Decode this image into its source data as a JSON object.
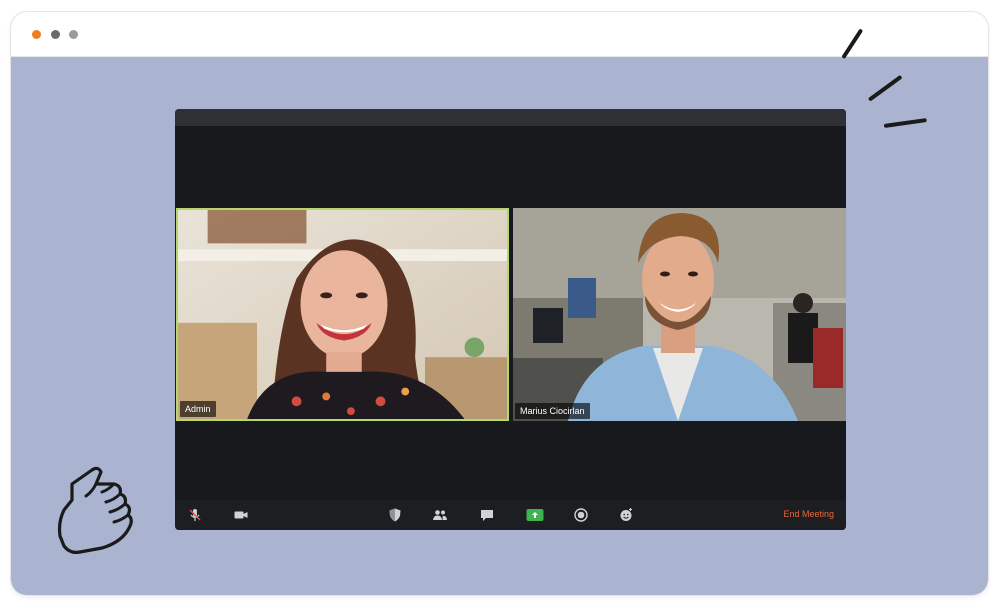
{
  "window": {
    "controls": [
      "close",
      "minimize",
      "maximize"
    ]
  },
  "meeting": {
    "participants": [
      {
        "name": "Admin",
        "active_speaker": true
      },
      {
        "name": "Marius Ciocirlan",
        "active_speaker": false
      }
    ],
    "toolbar": {
      "icons": [
        "mute-mic-icon",
        "video-camera-icon",
        "security-shield-icon",
        "participants-icon",
        "chat-icon",
        "share-screen-icon",
        "record-icon",
        "reactions-icon"
      ],
      "end_label": "End Meeting"
    }
  },
  "colors": {
    "background": "#aab3cf",
    "active_speaker_border": "#b6d769",
    "share_green": "#3fb34f",
    "end_meeting": "#e8683a",
    "accent_dot": "#f07d1d"
  }
}
